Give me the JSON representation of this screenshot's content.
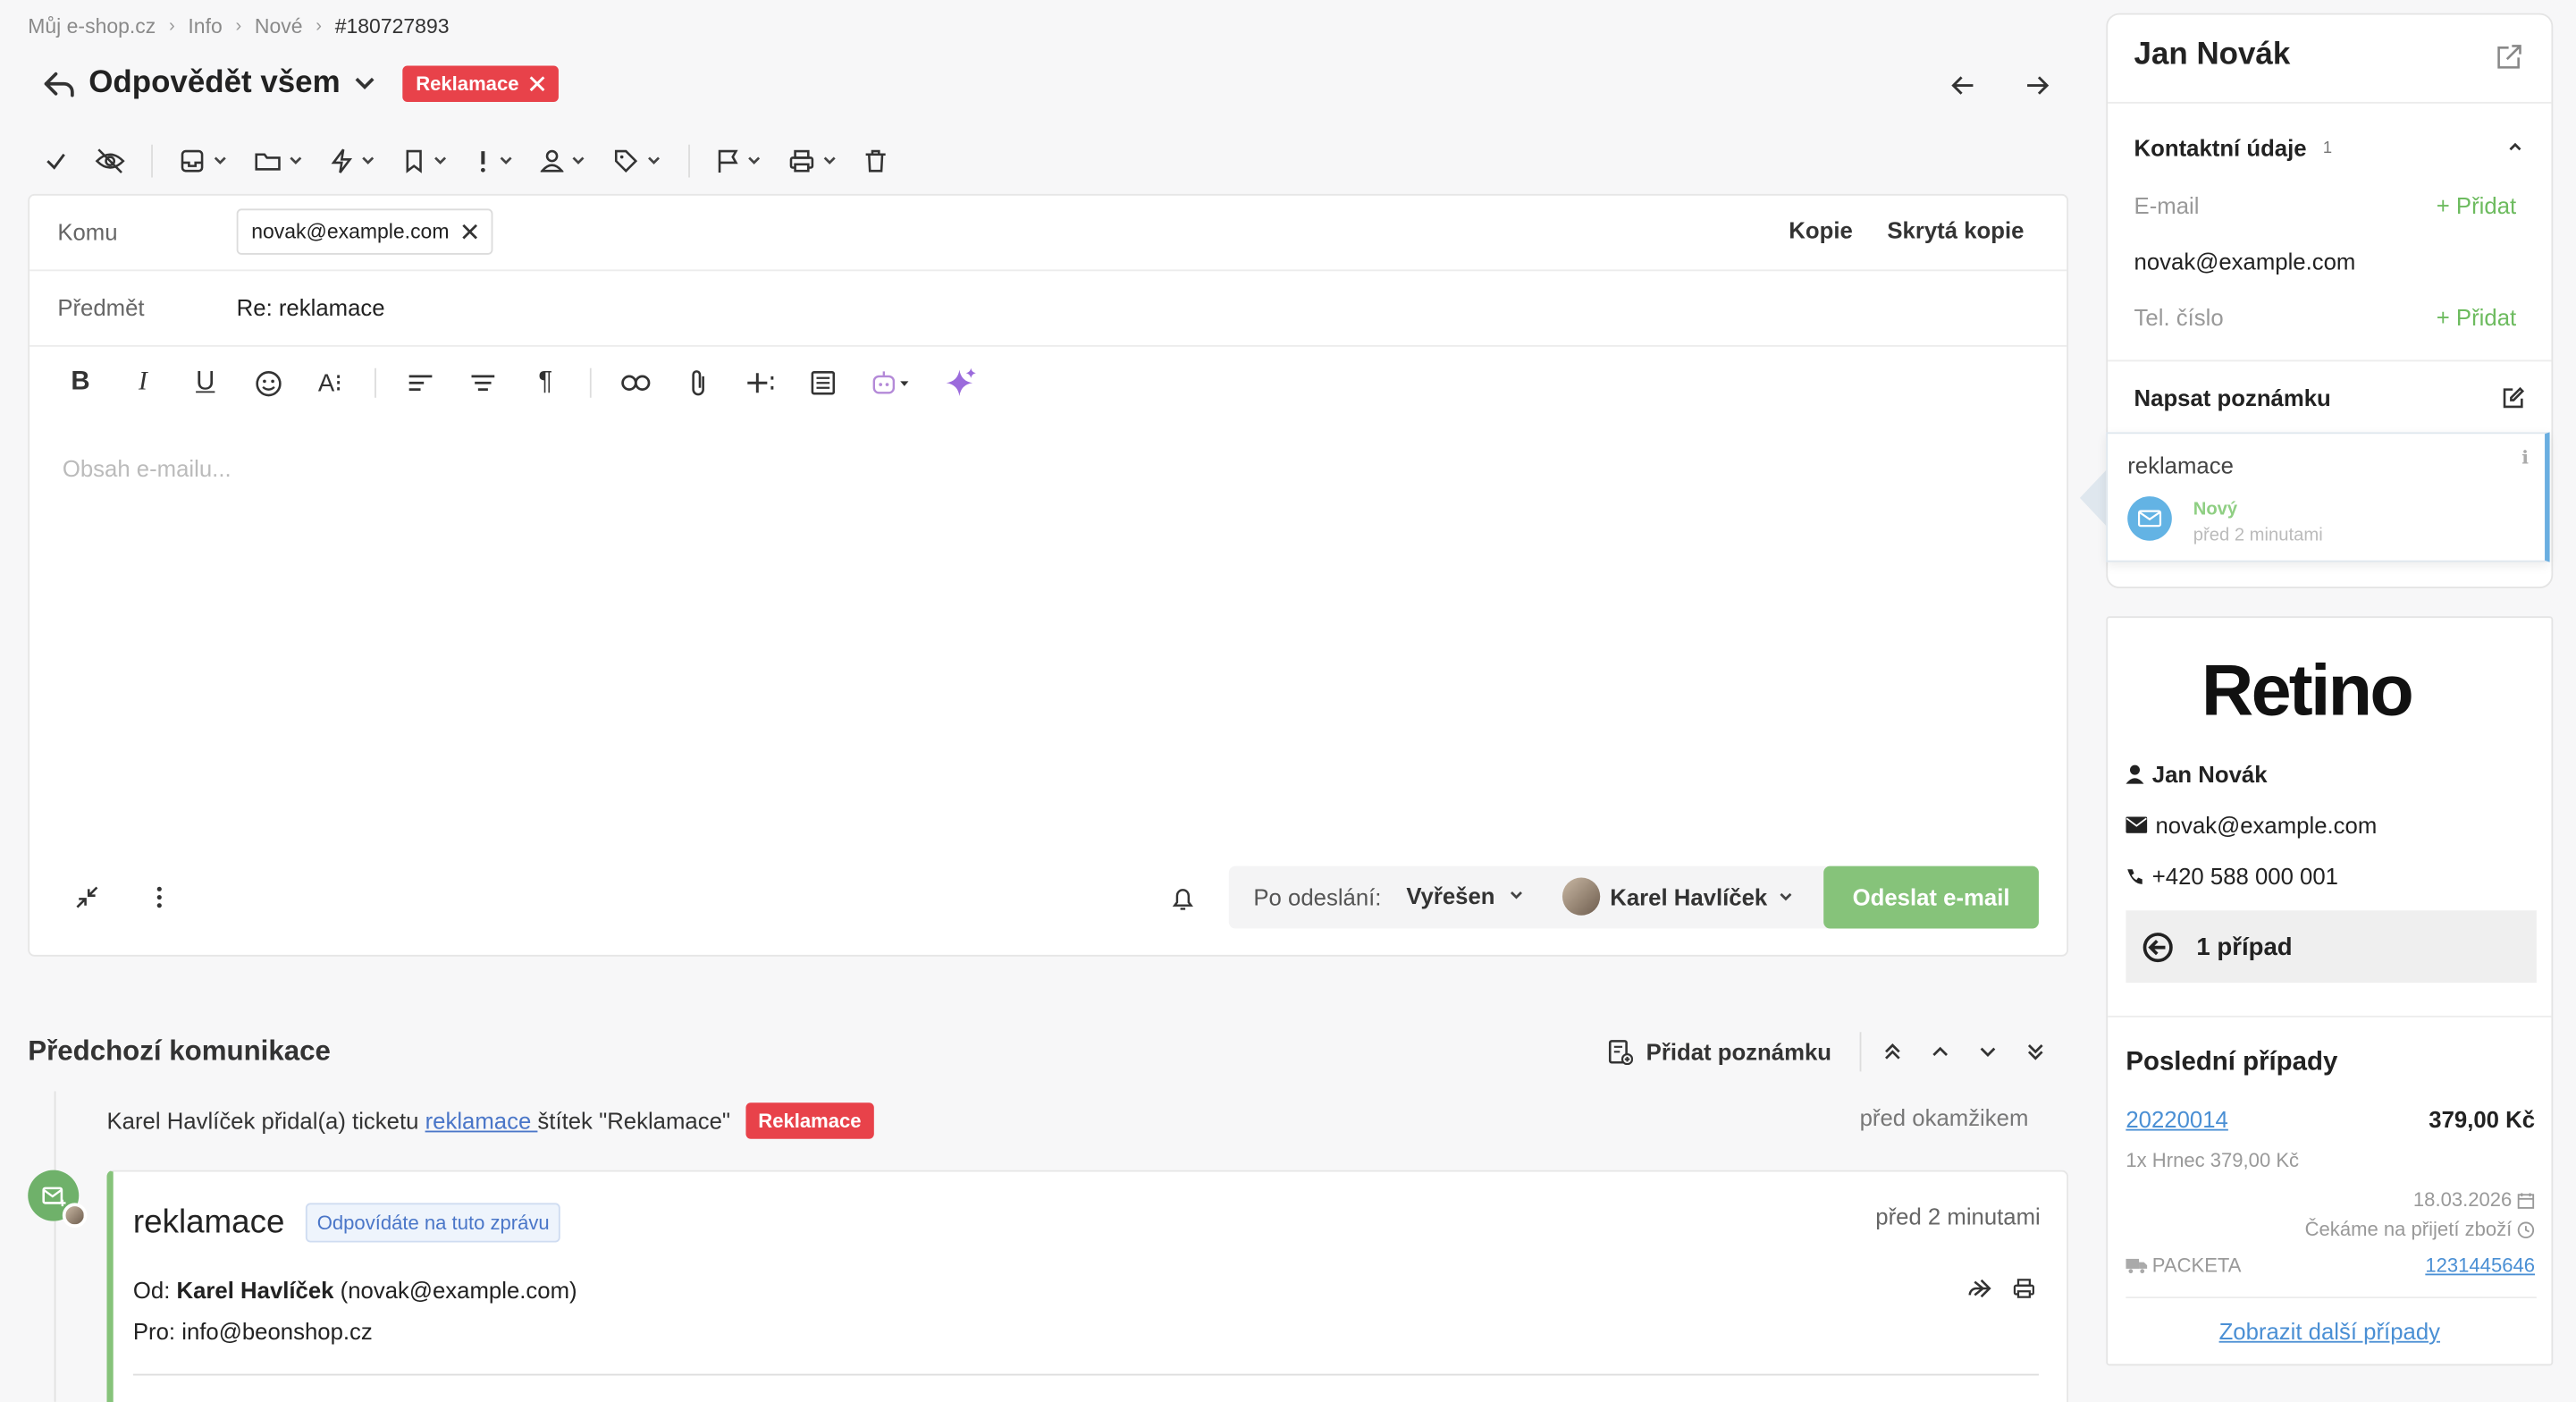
{
  "breadcrumb": [
    "Můj e-shop.cz",
    "Info",
    "Nové",
    "#180727893"
  ],
  "title": "Odpovědět všem",
  "title_tag": "Reklamace",
  "compose": {
    "to_label": "Komu",
    "to_chip": "novak@example.com",
    "cc_label": "Kopie",
    "bcc_label": "Skrytá kopie",
    "subject_label": "Předmět",
    "subject_value": "Re: reklamace",
    "body_placeholder": "Obsah e-mailu...",
    "after_send_label": "Po odeslání:",
    "after_send_value": "Vyřešen",
    "assignee": "Karel Havlíček",
    "send_button": "Odeslat e-mail"
  },
  "previous": {
    "title": "Předchozí komunikace",
    "add_note": "Přidat poznámku",
    "event_prefix": "Karel Havlíček přidal(a) ticketu ",
    "event_link": "reklamace ",
    "event_suffix": "štítek \"Reklamace\"",
    "event_tag": "Reklamace",
    "event_time": "před okamžikem",
    "mail_subject": "reklamace",
    "mail_badge": "Odpovídáte na tuto zprávu",
    "mail_time": "před 2 minutami",
    "from_label": "Od:",
    "from_name": "Karel Havlíček",
    "from_email": "(novak@example.com)",
    "to_label": "Pro:",
    "to_email": "info@beonshop.cz"
  },
  "contact": {
    "name": "Jan Novák",
    "section_title": "Kontaktní údaje",
    "section_count": "1",
    "email_label": "E-mail",
    "add": "+ Přidat",
    "email_value": "novak@example.com",
    "phone_label": "Tel. číslo",
    "note_title": "Napsat poznámku",
    "ticket_subject": "reklamace",
    "ticket_status": "Nový",
    "ticket_time": "před 2 minutami"
  },
  "retino": {
    "logo": "Retino",
    "name": "Jan Novák",
    "email": "novak@example.com",
    "phone": "+420 588 000 001",
    "cases": "1 případ",
    "recent_title": "Poslední případy",
    "case_id": "20220014",
    "case_price": "379,00 Kč",
    "case_item": "1x Hrnec 379,00 Kč",
    "case_date": "18.03.2026",
    "case_state": "Čekáme na přijetí zboží",
    "carrier": "PACKETA",
    "tracking": "1231445646",
    "more": "Zobrazit další případy"
  },
  "colors": {
    "accent_red": "#e8424a",
    "send_green": "#86c37a",
    "link_blue": "#4a8fd4"
  }
}
